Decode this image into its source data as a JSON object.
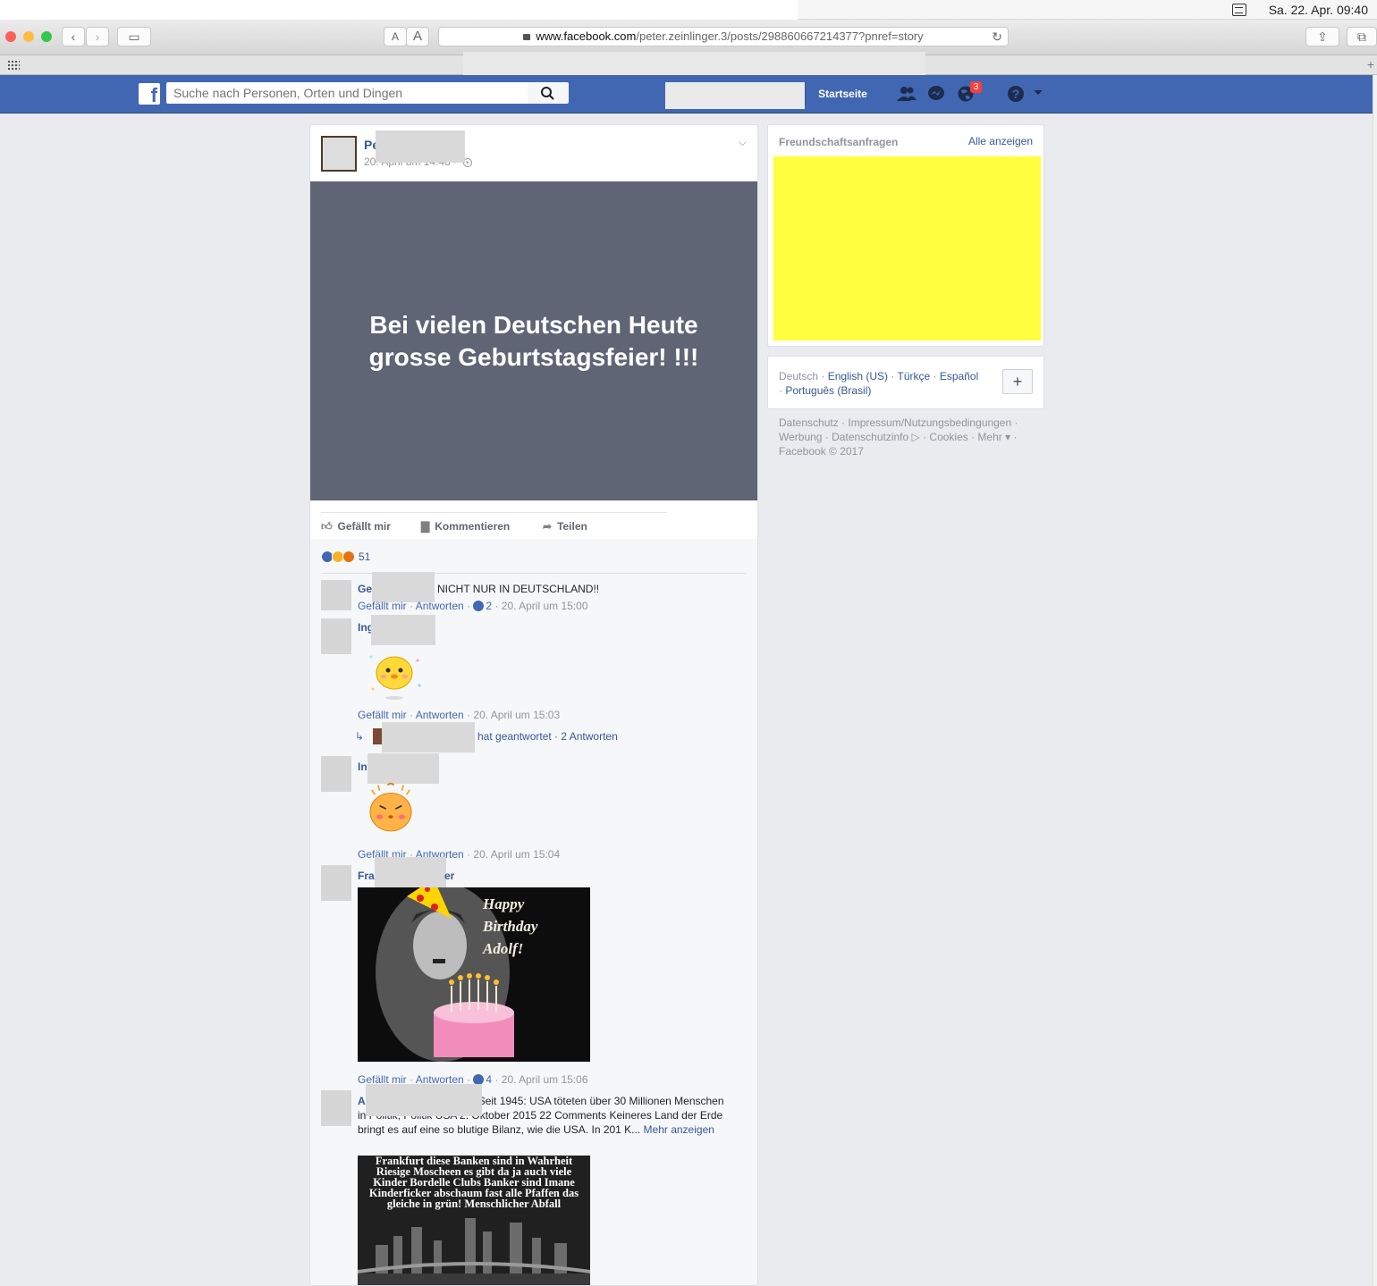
{
  "menubar": {
    "clock": "Sa. 22. Apr.  09:40"
  },
  "browser": {
    "url_host": "www.facebook.com",
    "url_path": "/peter.zeinlinger.3/posts/298860667214377?pnref=story",
    "font_small": "A",
    "font_large": "A"
  },
  "topbar": {
    "search_placeholder": "Suche nach Personen, Orten und Dingen",
    "home_label": "Startseite",
    "notification_count": "3"
  },
  "post": {
    "author": "Pe",
    "time": "20. April um 14:48 ·",
    "background_text": "Bei vielen Deutschen Heute grosse Geburtstagsfeier! !!!",
    "actions": {
      "like": "Gefällt mir",
      "comment": "Kommentieren",
      "share": "Teilen"
    },
    "reaction_count": "51"
  },
  "comments": [
    {
      "name": "Ge",
      "text": "NICHT NUR IN DEUTSCHLAND!!",
      "meta": {
        "like": "Gefällt mir",
        "reply": "Antworten",
        "likes": "2",
        "time": "20. April um 15:00"
      }
    },
    {
      "name": "Ing",
      "meta": {
        "like": "Gefällt mir",
        "reply": "Antworten",
        "time": "20. April um 15:03"
      },
      "replies": {
        "text": "hat geantwortet · 2 Antworten"
      }
    },
    {
      "name": "In",
      "meta": {
        "like": "Gefällt mir",
        "reply": "Antworten",
        "time": "20. April um 15:04"
      }
    },
    {
      "name": "Fra",
      "name_tail": "er",
      "image_text": [
        "Happy",
        "Birthday",
        "Adolf!"
      ],
      "meta": {
        "like": "Gefällt mir",
        "reply": "Antworten",
        "likes": "4",
        "time": "20. April um 15:06"
      }
    },
    {
      "name": "Al",
      "text_head": "Seit 1945: USA töteten über 30 Millionen Menschen",
      "text_body": "in Politik, Politik USA 2. Oktober 2015 22 Comments Keineres Land der Erde bringt es auf eine so blutige Bilanz, wie die USA. In 201 K...",
      "more": "Mehr anzeigen",
      "image_text": "Frankfurt diese Banken sind in Wahrheit Riesige Moscheen es gibt da ja auch viele Kinder Bordelle Clubs Banker sind Imane Kinderficker abschaum fast alle Pfaffen das gleiche in grün! Menschlicher Abfall"
    }
  ],
  "sidebar": {
    "friend_requests_title": "Freundschaftsanfragen",
    "see_all": "Alle anzeigen",
    "languages": {
      "current": "Deutsch",
      "others": [
        "English (US)",
        "Türkçe",
        "Español",
        "Português (Brasil)"
      ]
    },
    "footer": "Datenschutz · Impressum/Nutzungsbedingungen · Werbung · Datenschutzinfo ▷ · Cookies · Mehr ▾ · Facebook © 2017"
  },
  "colors": {
    "fb_blue": "#4267b2",
    "post_bg": "#5f6574",
    "highlight_yellow": "#ffff40"
  }
}
